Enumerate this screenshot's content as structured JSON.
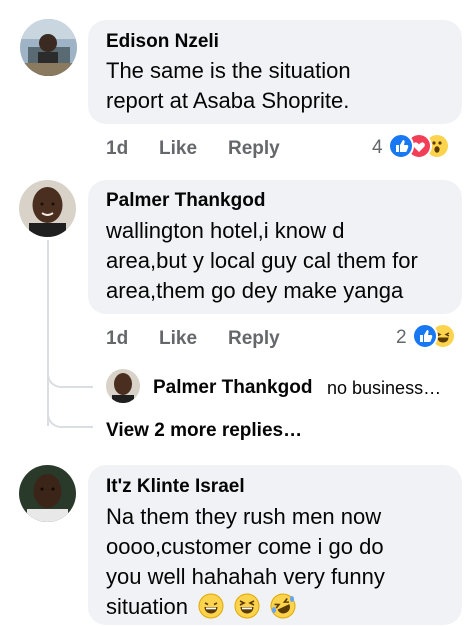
{
  "comments": [
    {
      "author": "Edison Nzeli",
      "lines": [
        "The same  is the situation",
        "report at Asaba Shoprite."
      ],
      "time": "1d",
      "like_label": "Like",
      "reply_label": "Reply",
      "reaction_count": "4",
      "reactions": [
        "like-icon",
        "love-icon",
        "wow-icon"
      ]
    },
    {
      "author": "Palmer Thankgod",
      "lines": [
        "wallington hotel,i know d",
        "area,but y local guy cal them for",
        "area,them go dey make yanga"
      ],
      "time": "1d",
      "like_label": "Like",
      "reply_label": "Reply",
      "reaction_count": "2",
      "reactions": [
        "like-icon",
        "haha-icon"
      ],
      "reply_preview": {
        "author": "Palmer Thankgod",
        "text": "no business…"
      },
      "view_more": "View 2 more replies…"
    },
    {
      "author": "It'z Klinte Israel",
      "lines": [
        "Na them they rush men now",
        "oooo,customer come i go do",
        "you well hahahah very funny",
        "situation"
      ],
      "emojis": [
        "grinning-squinting-emoji",
        "laughing-emoji",
        "rolling-laughing-emoji"
      ]
    }
  ],
  "colors": {
    "bubble": "#f0f2f5",
    "meta": "#65676b",
    "like_blue": "#1877f2",
    "love_red": "#f33e58",
    "emoji_yellow": "#fcd34d"
  }
}
